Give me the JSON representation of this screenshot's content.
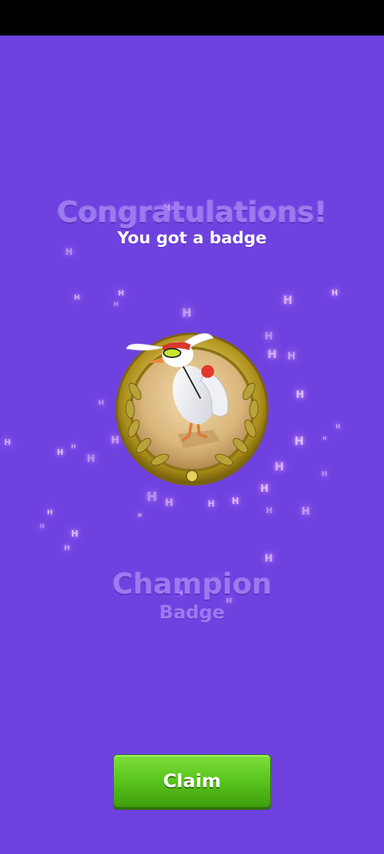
{
  "header": {
    "title": "Congratulations!",
    "subtitle": "You got a badge"
  },
  "badge": {
    "name": "Champion",
    "type": "Badge",
    "image": "champion-bird-medal"
  },
  "actions": {
    "claim_label": "Claim"
  },
  "colors": {
    "background": "#6f42e0",
    "headline": "#9b7af0",
    "claim_button": "#58c41c"
  },
  "decor": {
    "sparkle_glyph": "H"
  }
}
